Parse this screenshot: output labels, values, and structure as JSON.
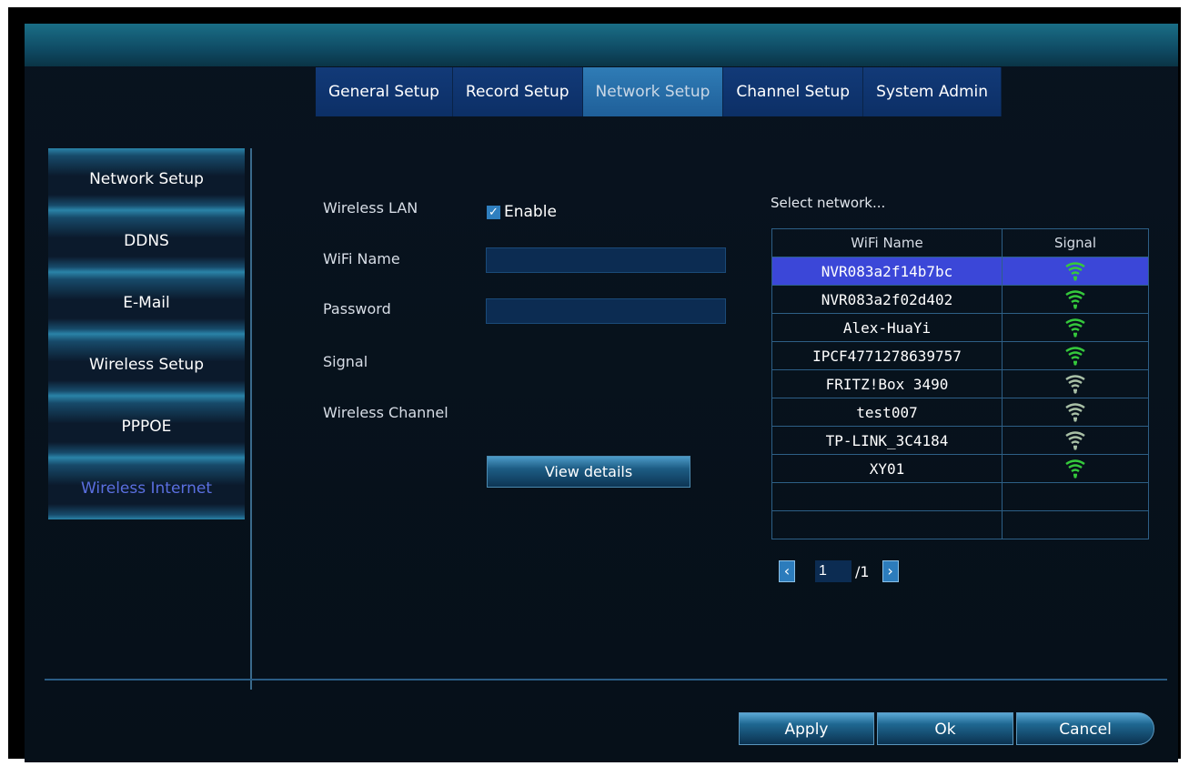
{
  "tabs": [
    {
      "label": "General Setup",
      "active": false
    },
    {
      "label": "Record Setup",
      "active": false
    },
    {
      "label": "Network Setup",
      "active": true
    },
    {
      "label": "Channel Setup",
      "active": false
    },
    {
      "label": "System Admin",
      "active": false
    }
  ],
  "sidebar": {
    "items": [
      {
        "label": "Network Setup"
      },
      {
        "label": "DDNS"
      },
      {
        "label": "E-Mail"
      },
      {
        "label": "Wireless Setup"
      },
      {
        "label": "PPPOE"
      },
      {
        "label": "Wireless Internet",
        "active": true
      }
    ]
  },
  "form": {
    "wireless_lan_label": "Wireless LAN",
    "enable_label": "Enable",
    "enable_checked": true,
    "wifi_name_label": "WiFi Name",
    "wifi_name_value": "",
    "password_label": "Password",
    "password_value": "",
    "signal_label": "Signal",
    "wireless_channel_label": "Wireless Channel",
    "view_details_label": "View details"
  },
  "network_list": {
    "title": "Select network...",
    "col_name": "WiFi Name",
    "col_signal": "Signal",
    "rows": [
      {
        "name": "NVR083a2f14b7bc",
        "signal_icon": "wifi-strong-icon",
        "selected": true
      },
      {
        "name": "NVR083a2f02d402",
        "signal_icon": "wifi-strong-icon"
      },
      {
        "name": "Alex-HuaYi",
        "signal_icon": "wifi-strong-icon"
      },
      {
        "name": "IPCF4771278639757",
        "signal_icon": "wifi-strong-icon"
      },
      {
        "name": "FRITZ!Box 3490",
        "signal_icon": "wifi-medium-icon"
      },
      {
        "name": "test007",
        "signal_icon": "wifi-medium-icon"
      },
      {
        "name": "TP-LINK_3C4184",
        "signal_icon": "wifi-medium-icon"
      },
      {
        "name": "XY01",
        "signal_icon": "wifi-strong-icon"
      },
      {
        "name": "",
        "signal_icon": ""
      },
      {
        "name": "",
        "signal_icon": ""
      }
    ]
  },
  "pager": {
    "current": "1",
    "total": "/1"
  },
  "footer": {
    "apply": "Apply",
    "ok": "Ok",
    "cancel": "Cancel"
  },
  "colors": {
    "accent": "#2f7cb6",
    "selected_row": "#3b47d8",
    "wifi_strong": "#35c93c",
    "wifi_medium": "#a9c0a6"
  }
}
